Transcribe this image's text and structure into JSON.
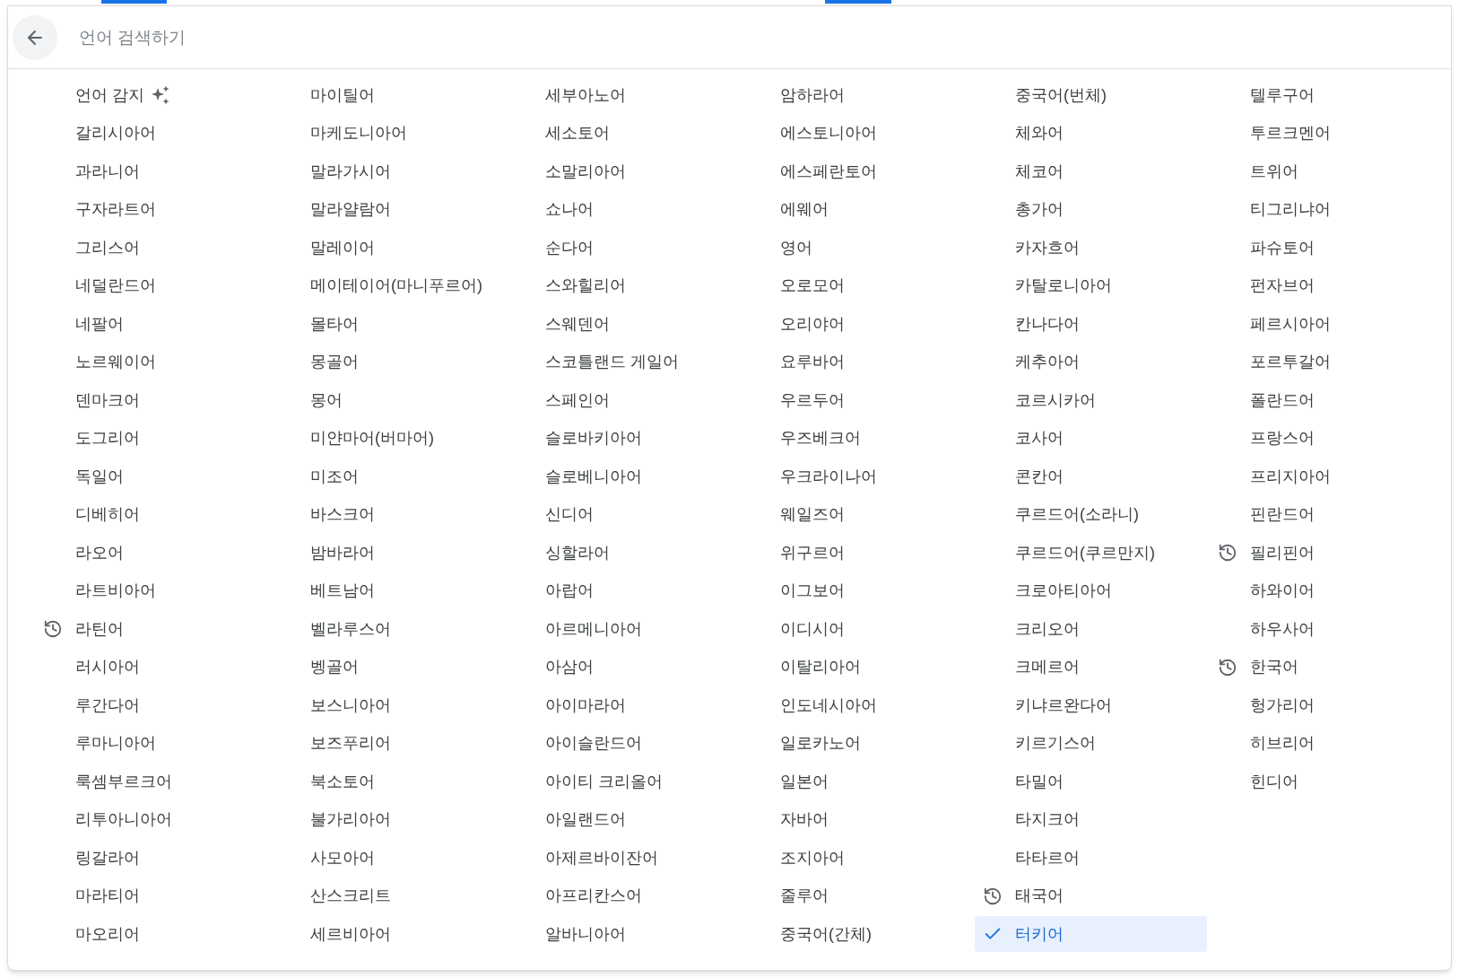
{
  "search": {
    "placeholder": "언어 검색하기"
  },
  "detect_language": {
    "label": "언어 감지"
  },
  "languages": [
    {
      "label": "갈리시아어",
      "recent": false,
      "selected": false
    },
    {
      "label": "과라니어",
      "recent": false,
      "selected": false
    },
    {
      "label": "구자라트어",
      "recent": false,
      "selected": false
    },
    {
      "label": "그리스어",
      "recent": false,
      "selected": false
    },
    {
      "label": "네덜란드어",
      "recent": false,
      "selected": false
    },
    {
      "label": "네팔어",
      "recent": false,
      "selected": false
    },
    {
      "label": "노르웨이어",
      "recent": false,
      "selected": false
    },
    {
      "label": "덴마크어",
      "recent": false,
      "selected": false
    },
    {
      "label": "도그리어",
      "recent": false,
      "selected": false
    },
    {
      "label": "독일어",
      "recent": false,
      "selected": false
    },
    {
      "label": "디베히어",
      "recent": false,
      "selected": false
    },
    {
      "label": "라오어",
      "recent": false,
      "selected": false
    },
    {
      "label": "라트비아어",
      "recent": false,
      "selected": false
    },
    {
      "label": "라틴어",
      "recent": true,
      "selected": false
    },
    {
      "label": "러시아어",
      "recent": false,
      "selected": false
    },
    {
      "label": "루간다어",
      "recent": false,
      "selected": false
    },
    {
      "label": "루마니아어",
      "recent": false,
      "selected": false
    },
    {
      "label": "룩셈부르크어",
      "recent": false,
      "selected": false
    },
    {
      "label": "리투아니아어",
      "recent": false,
      "selected": false
    },
    {
      "label": "링갈라어",
      "recent": false,
      "selected": false
    },
    {
      "label": "마라티어",
      "recent": false,
      "selected": false
    },
    {
      "label": "마오리어",
      "recent": false,
      "selected": false
    },
    {
      "label": "마이틸어",
      "recent": false,
      "selected": false
    },
    {
      "label": "마케도니아어",
      "recent": false,
      "selected": false
    },
    {
      "label": "말라가시어",
      "recent": false,
      "selected": false
    },
    {
      "label": "말라얄람어",
      "recent": false,
      "selected": false
    },
    {
      "label": "말레이어",
      "recent": false,
      "selected": false
    },
    {
      "label": "메이테이어(마니푸르어)",
      "recent": false,
      "selected": false
    },
    {
      "label": "몰타어",
      "recent": false,
      "selected": false
    },
    {
      "label": "몽골어",
      "recent": false,
      "selected": false
    },
    {
      "label": "몽어",
      "recent": false,
      "selected": false
    },
    {
      "label": "미얀마어(버마어)",
      "recent": false,
      "selected": false
    },
    {
      "label": "미조어",
      "recent": false,
      "selected": false
    },
    {
      "label": "바스크어",
      "recent": false,
      "selected": false
    },
    {
      "label": "밤바라어",
      "recent": false,
      "selected": false
    },
    {
      "label": "베트남어",
      "recent": false,
      "selected": false
    },
    {
      "label": "벨라루스어",
      "recent": false,
      "selected": false
    },
    {
      "label": "벵골어",
      "recent": false,
      "selected": false
    },
    {
      "label": "보스니아어",
      "recent": false,
      "selected": false
    },
    {
      "label": "보즈푸리어",
      "recent": false,
      "selected": false
    },
    {
      "label": "북소토어",
      "recent": false,
      "selected": false
    },
    {
      "label": "불가리아어",
      "recent": false,
      "selected": false
    },
    {
      "label": "사모아어",
      "recent": false,
      "selected": false
    },
    {
      "label": "산스크리트",
      "recent": false,
      "selected": false
    },
    {
      "label": "세르비아어",
      "recent": false,
      "selected": false
    },
    {
      "label": "세부아노어",
      "recent": false,
      "selected": false
    },
    {
      "label": "세소토어",
      "recent": false,
      "selected": false
    },
    {
      "label": "소말리아어",
      "recent": false,
      "selected": false
    },
    {
      "label": "쇼나어",
      "recent": false,
      "selected": false
    },
    {
      "label": "순다어",
      "recent": false,
      "selected": false
    },
    {
      "label": "스와힐리어",
      "recent": false,
      "selected": false
    },
    {
      "label": "스웨덴어",
      "recent": false,
      "selected": false
    },
    {
      "label": "스코틀랜드 게일어",
      "recent": false,
      "selected": false
    },
    {
      "label": "스페인어",
      "recent": false,
      "selected": false
    },
    {
      "label": "슬로바키아어",
      "recent": false,
      "selected": false
    },
    {
      "label": "슬로베니아어",
      "recent": false,
      "selected": false
    },
    {
      "label": "신디어",
      "recent": false,
      "selected": false
    },
    {
      "label": "싱할라어",
      "recent": false,
      "selected": false
    },
    {
      "label": "아랍어",
      "recent": false,
      "selected": false
    },
    {
      "label": "아르메니아어",
      "recent": false,
      "selected": false
    },
    {
      "label": "아삼어",
      "recent": false,
      "selected": false
    },
    {
      "label": "아이마라어",
      "recent": false,
      "selected": false
    },
    {
      "label": "아이슬란드어",
      "recent": false,
      "selected": false
    },
    {
      "label": "아이티 크리올어",
      "recent": false,
      "selected": false
    },
    {
      "label": "아일랜드어",
      "recent": false,
      "selected": false
    },
    {
      "label": "아제르바이잔어",
      "recent": false,
      "selected": false
    },
    {
      "label": "아프리칸스어",
      "recent": false,
      "selected": false
    },
    {
      "label": "알바니아어",
      "recent": false,
      "selected": false
    },
    {
      "label": "암하라어",
      "recent": false,
      "selected": false
    },
    {
      "label": "에스토니아어",
      "recent": false,
      "selected": false
    },
    {
      "label": "에스페란토어",
      "recent": false,
      "selected": false
    },
    {
      "label": "에웨어",
      "recent": false,
      "selected": false
    },
    {
      "label": "영어",
      "recent": false,
      "selected": false
    },
    {
      "label": "오로모어",
      "recent": false,
      "selected": false
    },
    {
      "label": "오리야어",
      "recent": false,
      "selected": false
    },
    {
      "label": "요루바어",
      "recent": false,
      "selected": false
    },
    {
      "label": "우르두어",
      "recent": false,
      "selected": false
    },
    {
      "label": "우즈베크어",
      "recent": false,
      "selected": false
    },
    {
      "label": "우크라이나어",
      "recent": false,
      "selected": false
    },
    {
      "label": "웨일즈어",
      "recent": false,
      "selected": false
    },
    {
      "label": "위구르어",
      "recent": false,
      "selected": false
    },
    {
      "label": "이그보어",
      "recent": false,
      "selected": false
    },
    {
      "label": "이디시어",
      "recent": false,
      "selected": false
    },
    {
      "label": "이탈리아어",
      "recent": false,
      "selected": false
    },
    {
      "label": "인도네시아어",
      "recent": false,
      "selected": false
    },
    {
      "label": "일로카노어",
      "recent": false,
      "selected": false
    },
    {
      "label": "일본어",
      "recent": false,
      "selected": false
    },
    {
      "label": "자바어",
      "recent": false,
      "selected": false
    },
    {
      "label": "조지아어",
      "recent": false,
      "selected": false
    },
    {
      "label": "줄루어",
      "recent": false,
      "selected": false
    },
    {
      "label": "중국어(간체)",
      "recent": false,
      "selected": false
    },
    {
      "label": "중국어(번체)",
      "recent": false,
      "selected": false
    },
    {
      "label": "체와어",
      "recent": false,
      "selected": false
    },
    {
      "label": "체코어",
      "recent": false,
      "selected": false
    },
    {
      "label": "총가어",
      "recent": false,
      "selected": false
    },
    {
      "label": "카자흐어",
      "recent": false,
      "selected": false
    },
    {
      "label": "카탈로니아어",
      "recent": false,
      "selected": false
    },
    {
      "label": "칸나다어",
      "recent": false,
      "selected": false
    },
    {
      "label": "케추아어",
      "recent": false,
      "selected": false
    },
    {
      "label": "코르시카어",
      "recent": false,
      "selected": false
    },
    {
      "label": "코사어",
      "recent": false,
      "selected": false
    },
    {
      "label": "콘칸어",
      "recent": false,
      "selected": false
    },
    {
      "label": "쿠르드어(소라니)",
      "recent": false,
      "selected": false
    },
    {
      "label": "쿠르드어(쿠르만지)",
      "recent": false,
      "selected": false
    },
    {
      "label": "크로아티아어",
      "recent": false,
      "selected": false
    },
    {
      "label": "크리오어",
      "recent": false,
      "selected": false
    },
    {
      "label": "크메르어",
      "recent": false,
      "selected": false
    },
    {
      "label": "키냐르완다어",
      "recent": false,
      "selected": false
    },
    {
      "label": "키르기스어",
      "recent": false,
      "selected": false
    },
    {
      "label": "타밀어",
      "recent": false,
      "selected": false
    },
    {
      "label": "타지크어",
      "recent": false,
      "selected": false
    },
    {
      "label": "타타르어",
      "recent": false,
      "selected": false
    },
    {
      "label": "태국어",
      "recent": true,
      "selected": false
    },
    {
      "label": "터키어",
      "recent": false,
      "selected": true
    },
    {
      "label": "텔루구어",
      "recent": false,
      "selected": false
    },
    {
      "label": "투르크멘어",
      "recent": false,
      "selected": false
    },
    {
      "label": "트위어",
      "recent": false,
      "selected": false
    },
    {
      "label": "티그리냐어",
      "recent": false,
      "selected": false
    },
    {
      "label": "파슈토어",
      "recent": false,
      "selected": false
    },
    {
      "label": "펀자브어",
      "recent": false,
      "selected": false
    },
    {
      "label": "페르시아어",
      "recent": false,
      "selected": false
    },
    {
      "label": "포르투갈어",
      "recent": false,
      "selected": false
    },
    {
      "label": "폴란드어",
      "recent": false,
      "selected": false
    },
    {
      "label": "프랑스어",
      "recent": false,
      "selected": false
    },
    {
      "label": "프리지아어",
      "recent": false,
      "selected": false
    },
    {
      "label": "핀란드어",
      "recent": false,
      "selected": false
    },
    {
      "label": "필리핀어",
      "recent": true,
      "selected": false
    },
    {
      "label": "하와이어",
      "recent": false,
      "selected": false
    },
    {
      "label": "하우사어",
      "recent": false,
      "selected": false
    },
    {
      "label": "한국어",
      "recent": true,
      "selected": false
    },
    {
      "label": "헝가리어",
      "recent": false,
      "selected": false
    },
    {
      "label": "히브리어",
      "recent": false,
      "selected": false
    },
    {
      "label": "힌디어",
      "recent": false,
      "selected": false
    }
  ]
}
